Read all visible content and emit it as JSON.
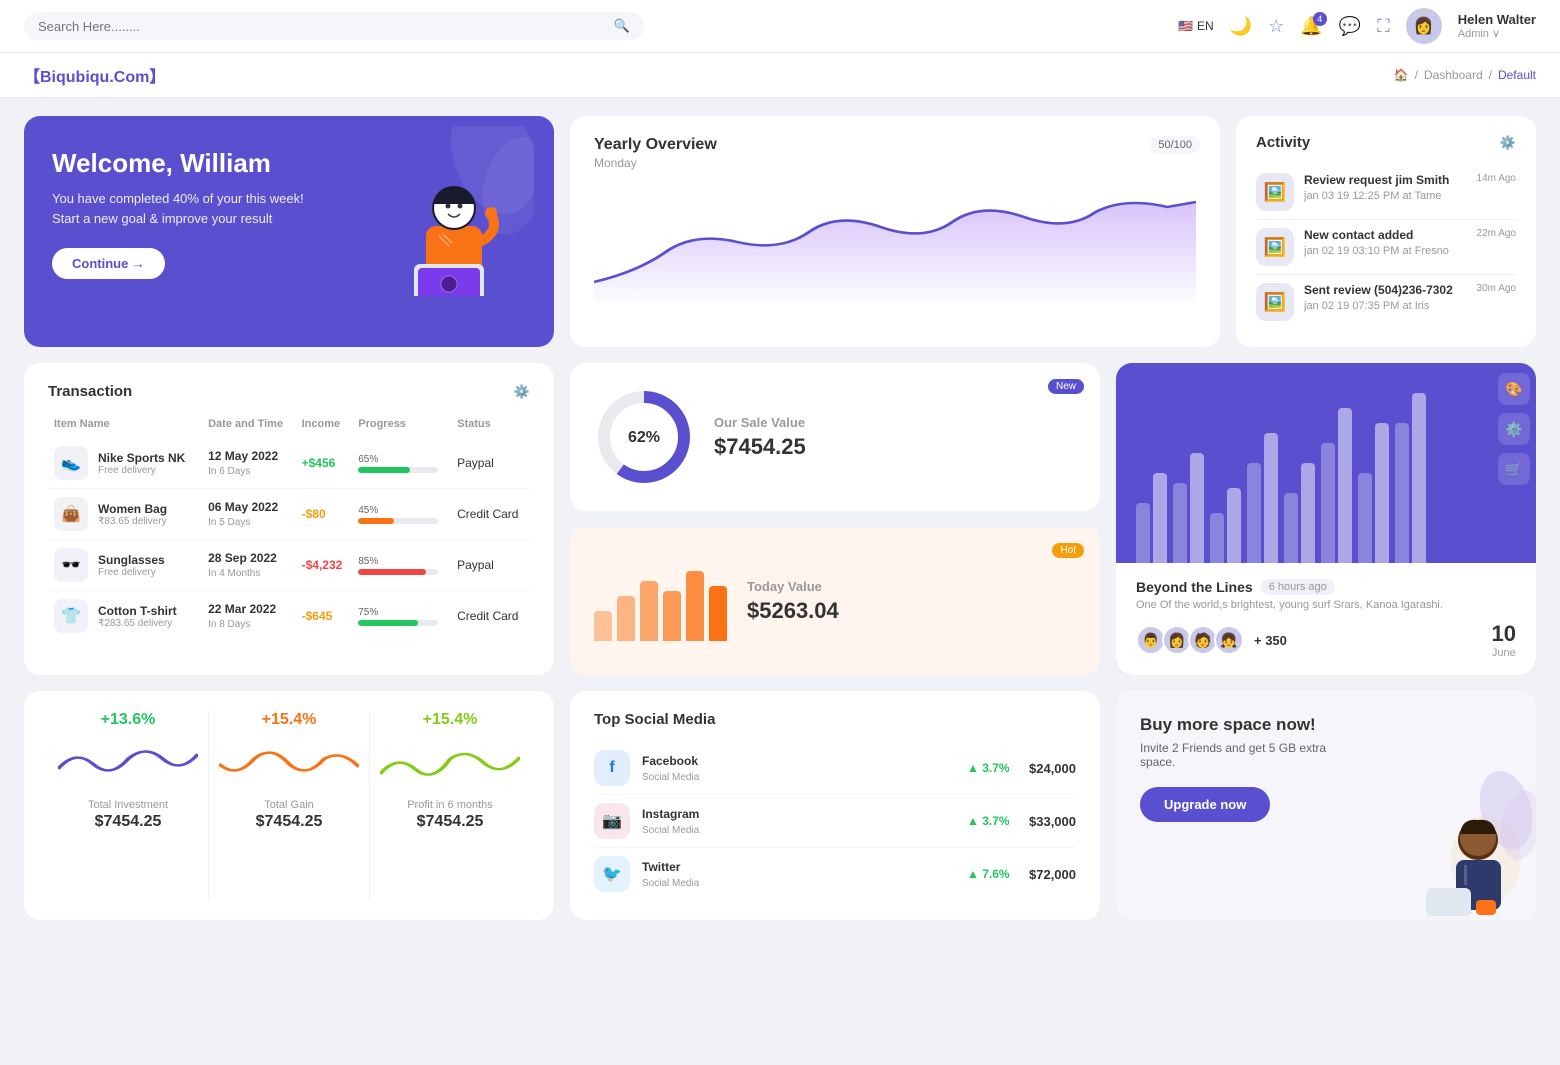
{
  "topnav": {
    "search_placeholder": "Search Here........",
    "lang": "EN",
    "notification_count": "4",
    "user_name": "Helen Walter",
    "user_role": "Admin ∨"
  },
  "breadcrumb": {
    "brand": "【Biqubiqu.Com】",
    "home": "🏠",
    "separator": "/",
    "dashboard": "Dashboard",
    "current": "Default"
  },
  "welcome": {
    "title": "Welcome, William",
    "subtitle": "You have completed 40% of your this week! Start a new goal & improve your result",
    "button": "Continue →"
  },
  "yearly": {
    "title": "Yearly Overview",
    "day": "Monday",
    "badge": "50/100"
  },
  "activity": {
    "title": "Activity",
    "items": [
      {
        "name": "Review request jim Smith",
        "detail": "jan 03 19 12:25 PM at Tame",
        "time": "14m Ago",
        "emoji": "🖼️"
      },
      {
        "name": "New contact added",
        "detail": "jan 02 19 03:10 PM at Fresno",
        "time": "22m Ago",
        "emoji": "🖼️"
      },
      {
        "name": "Sent review (504)236-7302",
        "detail": "jan 02 19 07:35 PM at Iris",
        "time": "30m Ago",
        "emoji": "🖼️"
      }
    ]
  },
  "transaction": {
    "title": "Transaction",
    "headers": [
      "Item Name",
      "Date and Time",
      "Income",
      "Progress",
      "Status"
    ],
    "rows": [
      {
        "name": "Nike Sports NK",
        "sub": "Free delivery",
        "date": "12 May 2022",
        "days": "In 6 Days",
        "income": "+$456",
        "income_type": "pos",
        "pct": "65%",
        "bar_color": "#22c55e",
        "status": "Paypal",
        "emoji": "👟"
      },
      {
        "name": "Women Bag",
        "sub": "₹83.65 delivery",
        "date": "06 May 2022",
        "days": "In 5 Days",
        "income": "-$80",
        "income_type": "neg",
        "pct": "45%",
        "bar_color": "#f97316",
        "status": "Credit Card",
        "emoji": "👜"
      },
      {
        "name": "Sunglasses",
        "sub": "Free delivery",
        "date": "28 Sep 2022",
        "days": "In 4 Months",
        "income": "-$4,232",
        "income_type": "red",
        "pct": "85%",
        "bar_color": "#ef4444",
        "status": "Paypal",
        "emoji": "🕶️"
      },
      {
        "name": "Cotton T-shirt",
        "sub": "₹283.65 delivery",
        "date": "22 Mar 2022",
        "days": "In 8 Days",
        "income": "-$645",
        "income_type": "neg",
        "pct": "75%",
        "bar_color": "#22c55e",
        "status": "Credit Card",
        "emoji": "👕"
      }
    ]
  },
  "sale_value": {
    "badge": "New",
    "donut_pct": "62%",
    "label": "Our Sale Value",
    "amount": "$7454.25"
  },
  "today_value": {
    "badge": "Hot",
    "label": "Today Value",
    "amount": "$5263.04"
  },
  "beyond": {
    "title": "Beyond the Lines",
    "time_ago": "6 hours ago",
    "desc": "One Of the world,s brightest, young surf Srars, Kanoa Igarashi.",
    "plus_count": "+ 350",
    "date_num": "10",
    "date_month": "June"
  },
  "mini_stats": [
    {
      "pct": "+13.6%",
      "color": "green",
      "label": "Total Investment",
      "value": "$7454.25"
    },
    {
      "pct": "+15.4%",
      "color": "orange",
      "label": "Total Gain",
      "value": "$7454.25"
    },
    {
      "pct": "+15.4%",
      "color": "lime",
      "label": "Profit in 6 months",
      "value": "$7454.25"
    }
  ],
  "social": {
    "title": "Top Social Media",
    "items": [
      {
        "name": "Facebook",
        "sub": "Social Media",
        "pct": "▲ 3.7%",
        "amount": "$24,000",
        "color": "#1877f2",
        "emoji": "f"
      },
      {
        "name": "Instagram",
        "sub": "Social Media",
        "pct": "▲ 3.7%",
        "amount": "$33,000",
        "color": "#e1306c",
        "emoji": "📷"
      },
      {
        "name": "Twitter",
        "sub": "Social Media",
        "pct": "▲ 7.6%",
        "amount": "$72,000",
        "color": "#1da1f2",
        "emoji": "🐦"
      }
    ]
  },
  "space": {
    "title": "Buy more space now!",
    "desc": "Invite 2 Friends and get 5 GB extra space.",
    "button": "Upgrade now"
  }
}
